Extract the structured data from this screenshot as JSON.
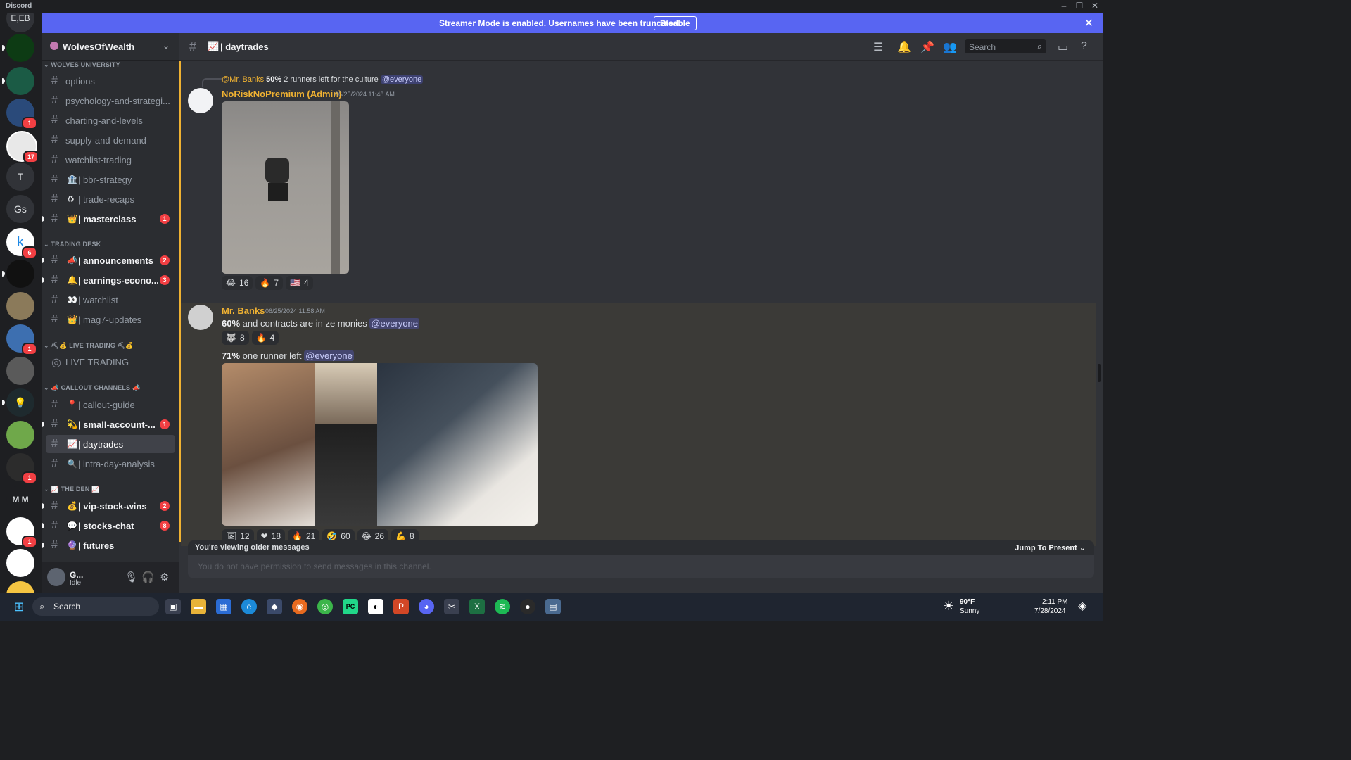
{
  "app": {
    "title": "Discord",
    "self_short": "E,EB"
  },
  "streamer": {
    "message": "Streamer Mode is enabled. Usernames have been truncated.",
    "button": "Disable"
  },
  "server": {
    "name": "WolvesOfWealth"
  },
  "categories": {
    "wolves_university": "WOLVES UNIVERSITY",
    "trading_desk": "TRADING DESK",
    "live_trading": "LIVE TRADING",
    "callout_channels": "CALLOUT CHANNELS",
    "the_den": "THE DEN"
  },
  "channels": [
    {
      "label": "options",
      "emoji": ""
    },
    {
      "label": "psychology-and-strategi...",
      "emoji": ""
    },
    {
      "label": "charting-and-levels",
      "emoji": ""
    },
    {
      "label": "supply-and-demand",
      "emoji": ""
    },
    {
      "label": "watchlist-trading",
      "emoji": ""
    },
    {
      "label": "| bbr-strategy",
      "emoji": "🏦"
    },
    {
      "label": "| trade-recaps",
      "emoji": "♻"
    },
    {
      "label": "| masterclass",
      "emoji": "👑",
      "badge": "1"
    },
    {
      "label": "| announcements",
      "emoji": "📣",
      "badge": "2"
    },
    {
      "label": "| earnings-econo...",
      "emoji": "🔔",
      "badge": "3"
    },
    {
      "label": "| watchlist",
      "emoji": "👀"
    },
    {
      "label": "| mag7-updates",
      "emoji": "👑"
    },
    {
      "label": "LIVE TRADING",
      "emoji": ""
    },
    {
      "label": "| callout-guide",
      "emoji": "📍"
    },
    {
      "label": "| small-account-...",
      "emoji": "💫",
      "badge": "1"
    },
    {
      "label": "| daytrades",
      "emoji": "📈"
    },
    {
      "label": "| intra-day-analysis",
      "emoji": "🔍"
    },
    {
      "label": "| vip-stock-wins",
      "emoji": "💰",
      "badge": "2"
    },
    {
      "label": "| stocks-chat",
      "emoji": "💬",
      "badge": "8"
    },
    {
      "label": "| futures",
      "emoji": "🔮"
    }
  ],
  "guild_labels": {
    "t": "T",
    "gs": "Gs",
    "k": "k",
    "mm": "M M"
  },
  "guild_badges": [
    "1",
    "17",
    "6",
    "1",
    "1",
    "1"
  ],
  "user": {
    "name": "G...",
    "status": "Idle"
  },
  "header": {
    "channel": "daytrades",
    "emoji": "📈",
    "search_placeholder": "Search"
  },
  "messages": {
    "reply": {
      "author": "@Mr. Banks",
      "pct": "50%",
      "text": "2 runners left for the culture",
      "mention": "@everyone"
    },
    "m1": {
      "author": "NoRiskNoPremium (Admin)",
      "time": "06/25/2024 11:48 AM",
      "reactions": [
        {
          "emoji": "😂",
          "count": "16"
        },
        {
          "emoji": "🔥",
          "count": "7"
        },
        {
          "emoji": "🇺🇸",
          "count": "4"
        }
      ]
    },
    "m2": {
      "author": "Mr. Banks",
      "time": "06/25/2024 11:58 AM",
      "line1_pct": "60%",
      "line1_text": "and contracts are in ze monies",
      "line1_mention": "@everyone",
      "reactions1": [
        {
          "emoji": "🐺",
          "count": "8"
        },
        {
          "emoji": "🔥",
          "count": "4"
        }
      ],
      "line2_pct": "71%",
      "line2_text": "one runner left",
      "line2_mention": "@everyone",
      "reactions2": [
        {
          "emoji": "🖼",
          "count": "12"
        },
        {
          "emoji": "❤",
          "count": "18"
        },
        {
          "emoji": "🔥",
          "count": "21"
        },
        {
          "emoji": "🤣",
          "count": "60"
        },
        {
          "emoji": "😂",
          "count": "26"
        },
        {
          "emoji": "💪",
          "count": "8"
        }
      ]
    }
  },
  "footer": {
    "older": "You're viewing older messages",
    "jump": "Jump To Present",
    "composer": "You do not have permission to send messages in this channel."
  },
  "taskbar": {
    "search": "Search",
    "weather_temp": "90°F",
    "weather_desc": "Sunny",
    "time": "2:11 PM",
    "date": "7/28/2024"
  },
  "colors": {
    "accent": "#5865f2",
    "unread_badge": "#f23f43",
    "highlight": "#f0b232"
  }
}
